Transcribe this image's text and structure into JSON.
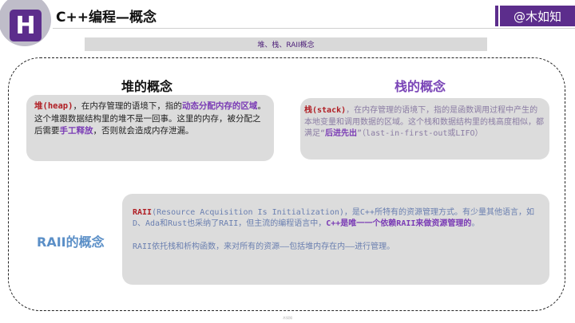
{
  "header": {
    "logo_letter": "H",
    "title": "C++编程—概念",
    "brand": "@木如知"
  },
  "banner": "堆、栈、RAII概念",
  "heap": {
    "title": "堆的概念",
    "term": "堆(heap)",
    "t1": "，在内存管理的语境下，指的",
    "em1": "动态分配内存的区域",
    "t2": "。这个堆跟数据结构里的堆不是一回事。这里的内存，被分配之后需要",
    "em2": "手工释放",
    "t3": "，否则就会造成内存泄漏。"
  },
  "stack": {
    "title": "栈的概念",
    "term": "栈(stack)",
    "t1": "，在内存管理的语境下，指的是函数调用过程中产生的本地变量和调用数据的区域。这个栈和数据结构里的栈高度相似，都满足“",
    "em1": "后进先出",
    "t2": "”（last-in-first-out或LIFO）"
  },
  "raii": {
    "title": "RAII的概念",
    "term": "RAII",
    "t1": "(Resource Acquisition Is Initialization)，是C++所特有的资源管理方式。有少量其他语言，如D、Ada和Rust也采纳了RAII，但主流的编程语言中，",
    "em1": "C++是唯一一个依赖RAII来做资源管理的",
    "t2": "。",
    "p2": "RAII依托栈和析构函数，来对所有的资源——包括堆内存在内——进行管理。"
  },
  "footer": "木如知",
  "colors": {
    "purple": "#5c2d8c",
    "accent_red": "#b01e24",
    "accent_purple": "#7a3bb5",
    "raii_blue": "#5b8fc7"
  }
}
